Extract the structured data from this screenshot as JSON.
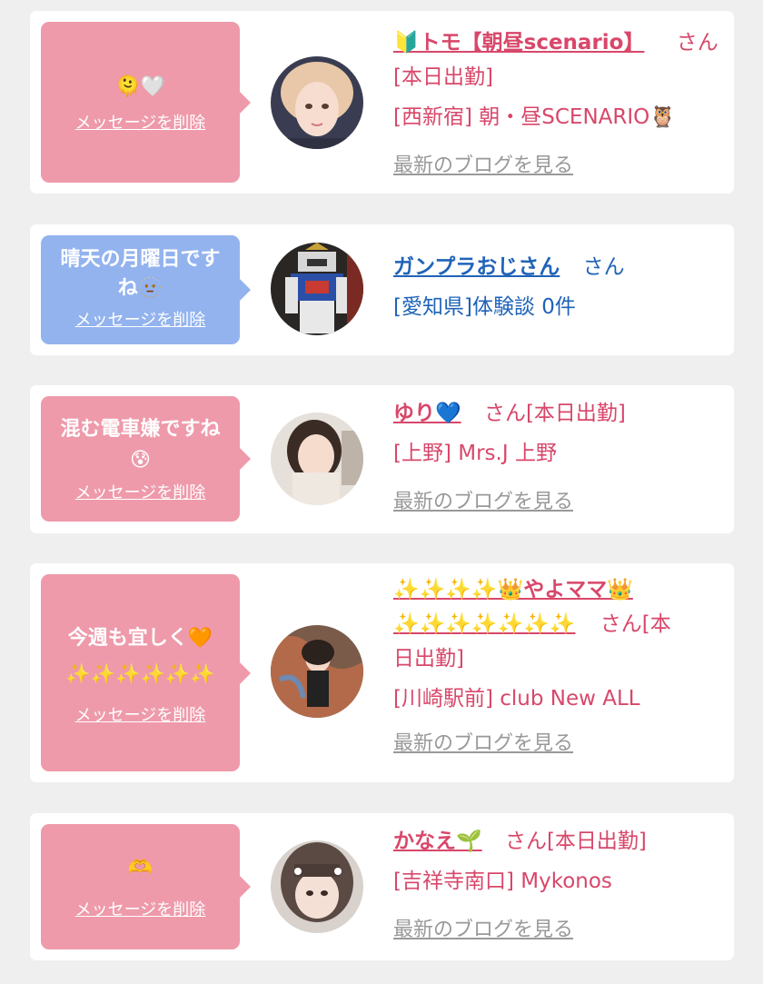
{
  "entries": [
    {
      "message": "🫠🤍",
      "delete_label": "メッセージを削除",
      "name": "🔰トモ【朝昼scenario】",
      "honorific": "さん",
      "status": "[本日出勤]",
      "area": "[西新宿] 朝・昼SCENARIO🦉",
      "blog_label": "最新のブログを見る"
    },
    {
      "message": "晴天の月曜日です\nね🫥",
      "delete_label": "メッセージを削除",
      "name": "ガンプラおじさん",
      "honorific": "さん",
      "area": "[愛知県]体験談 0件"
    },
    {
      "message": "混む電車嫌ですね\n😰",
      "delete_label": "メッセージを削除",
      "name": "ゆり💙",
      "honorific": "さん",
      "status": "[本日出勤]",
      "area": "[上野] Mrs.J 上野",
      "blog_label": "最新のブログを見る"
    },
    {
      "message": "今週も宜しく🧡\n✨✨✨✨✨✨",
      "delete_label": "メッセージを削除",
      "name_line1": "✨✨✨✨👑やよママ👑",
      "name_line2": "✨✨✨✨✨✨✨",
      "honorific": "さん",
      "status_part1": "[本",
      "status_part2": "日出勤]",
      "area": "[川崎駅前] club New ALL",
      "blog_label": "最新のブログを見る"
    },
    {
      "message": "🫶",
      "delete_label": "メッセージを削除",
      "name": "かなえ🌱",
      "honorific": "さん",
      "status": "[本日出勤]",
      "area": "[吉祥寺南口] Mykonos",
      "blog_label": "最新のブログを見る"
    }
  ],
  "colors": {
    "page_bg": "#efefef",
    "card_bg": "#ffffff",
    "bubble_pink": "#ee9aaa",
    "bubble_blue": "#93b3ef",
    "name_pink": "#d8476a",
    "name_blue": "#1f63b8",
    "blog_gray": "#999999"
  }
}
